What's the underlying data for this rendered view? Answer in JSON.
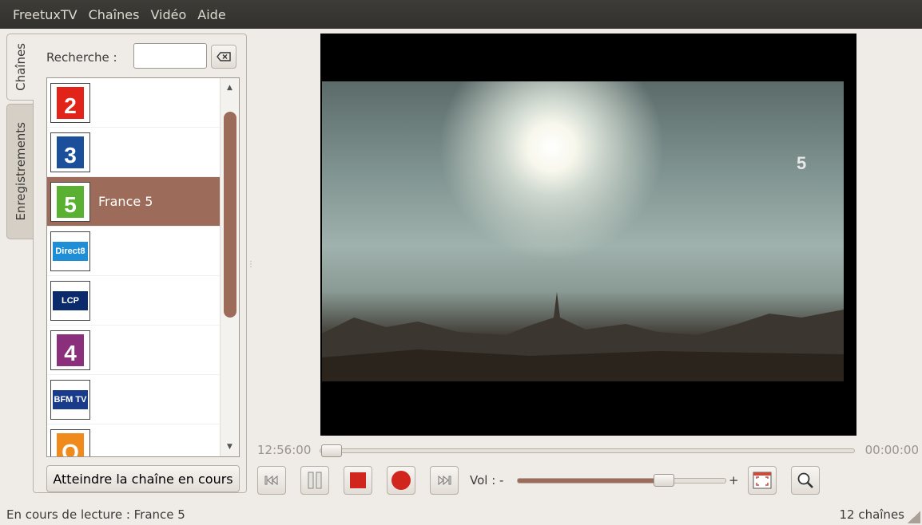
{
  "menubar": {
    "items": [
      "FreetuxTV",
      "Chaînes",
      "Vidéo",
      "Aide"
    ]
  },
  "tabs": {
    "channels": "Chaînes",
    "recordings": "Enregistrements"
  },
  "search": {
    "label": "Recherche :",
    "value": "",
    "clear_icon": "clear-text-icon"
  },
  "channels": [
    {
      "logo": "2",
      "color": "#e32219",
      "name": ""
    },
    {
      "logo": "3",
      "color": "#1b4e9b",
      "name": ""
    },
    {
      "logo": "5",
      "color": "#59b031",
      "name": "France 5",
      "selected": true
    },
    {
      "logo": "Direct8",
      "color": "#1e8fd6",
      "name": ""
    },
    {
      "logo": "LCP",
      "color": "#0a2a6b",
      "name": ""
    },
    {
      "logo": "4",
      "color": "#8b2f7d",
      "name": ""
    },
    {
      "logo": "BFM TV",
      "color": "#1a3a8a",
      "name": ""
    },
    {
      "logo": "O",
      "color": "#f08a1d",
      "name": ""
    }
  ],
  "goto_button": "Atteindre la chaîne en cours",
  "player": {
    "watermark": "5",
    "time_current": "12:56:00",
    "time_total": "00:00:00",
    "progress": 0.0,
    "volume_label": "Vol : -",
    "volume_plus": "+",
    "volume_level": 0.72
  },
  "status": {
    "playing": "En cours de lecture : France 5",
    "count": "12 chaînes"
  },
  "colors": {
    "accent": "#9c6b59",
    "record": "#d0261e",
    "stop": "#d0261e"
  }
}
